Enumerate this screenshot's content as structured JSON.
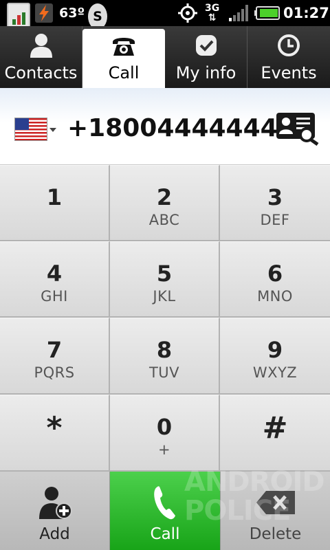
{
  "status_bar": {
    "temperature": "63º",
    "skype_letter": "S",
    "network": "3G",
    "network_arrows": "⇅",
    "time": "01:27",
    "icons": [
      "chart-app-icon",
      "flash-icon",
      "skype-icon",
      "gps-icon",
      "network-3g-icon",
      "signal-icon",
      "battery-icon"
    ]
  },
  "tabs": [
    {
      "label": "Contacts",
      "icon": "person-icon"
    },
    {
      "label": "Call",
      "icon": "phone-icon",
      "active": true
    },
    {
      "label": "My info",
      "icon": "checkmark-badge-icon"
    },
    {
      "label": "Events",
      "icon": "clock-icon"
    }
  ],
  "display": {
    "country": "us-flag-icon",
    "number": "+18004444444",
    "search_icon": "contact-search-icon"
  },
  "keypad": [
    {
      "digit": "1",
      "letters": ""
    },
    {
      "digit": "2",
      "letters": "ABC"
    },
    {
      "digit": "3",
      "letters": "DEF"
    },
    {
      "digit": "4",
      "letters": "GHI"
    },
    {
      "digit": "5",
      "letters": "JKL"
    },
    {
      "digit": "6",
      "letters": "MNO"
    },
    {
      "digit": "7",
      "letters": "PQRS"
    },
    {
      "digit": "8",
      "letters": "TUV"
    },
    {
      "digit": "9",
      "letters": "WXYZ"
    },
    {
      "digit": "*",
      "letters": ""
    },
    {
      "digit": "0",
      "letters": "+"
    },
    {
      "digit": "#",
      "letters": ""
    }
  ],
  "actions": {
    "add_label": "Add",
    "call_label": "Call",
    "delete_label": "Delete"
  },
  "watermark": {
    "line1": "ANDROID",
    "line2": "POLICE"
  },
  "colors": {
    "call_green": "#22b022",
    "tab_dark": "#262626",
    "keypad_gray": "#e2e2e2"
  }
}
